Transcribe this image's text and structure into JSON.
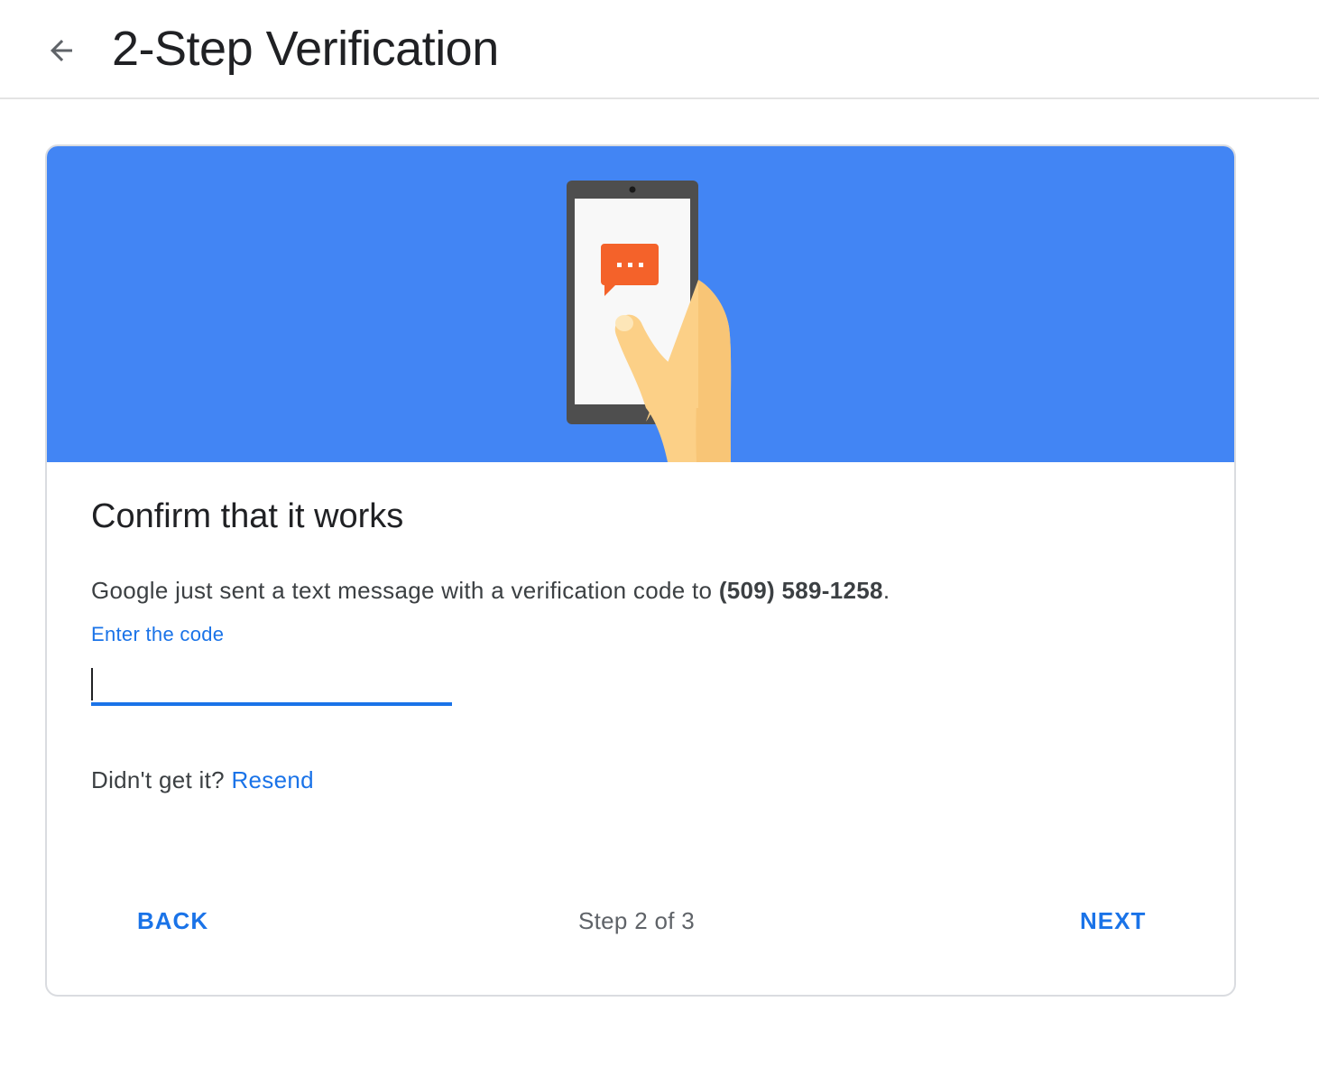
{
  "header": {
    "title": "2-Step Verification",
    "back_icon": "arrow-back-icon"
  },
  "card": {
    "banner_color": "#4285f4",
    "illustration": "phone-text-message-illustration",
    "title": "Confirm that it works",
    "message_prefix": "Google just sent a text message with a verification code to ",
    "phone_number": "(509) 589-1258",
    "message_suffix": ".",
    "code_label": "Enter the code",
    "code_value": "",
    "resend_prefix": "Didn't get it? ",
    "resend_link": "Resend"
  },
  "footer": {
    "back_label": "BACK",
    "step_text": "Step 2 of 3",
    "next_label": "NEXT"
  },
  "colors": {
    "accent": "#1a73e8",
    "banner": "#4285f4",
    "message_bubble": "#f4622a"
  }
}
